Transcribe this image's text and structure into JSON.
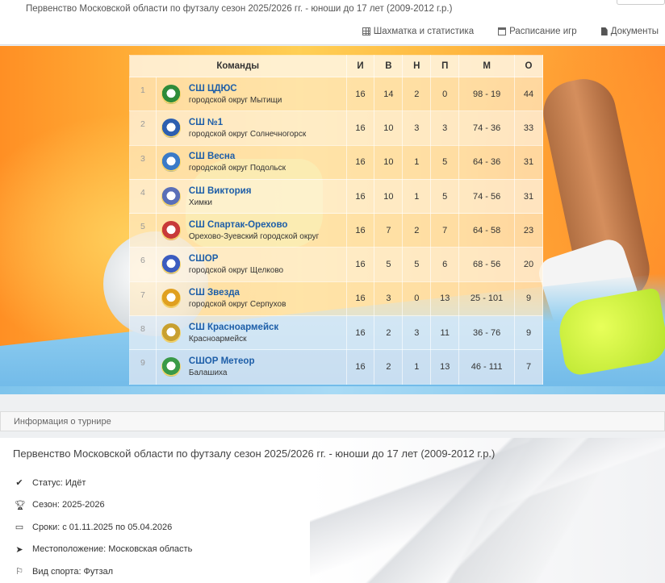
{
  "header": {
    "title": "Первенство Московской области по футзалу сезон 2025/2026 гг. - юноши до 17 лет (2009-2012 г.р.)",
    "nav": [
      {
        "label": "Шахматка и статистика",
        "icon": "grid-icon"
      },
      {
        "label": "Расписание игр",
        "icon": "calendar-icon"
      },
      {
        "label": "Документы",
        "icon": "document-icon"
      }
    ]
  },
  "standings": {
    "headers": {
      "team": "Команды",
      "games": "И",
      "wins": "В",
      "draws": "Н",
      "losses": "П",
      "goals": "М",
      "points": "О"
    },
    "rows": [
      {
        "pos": "1",
        "name": "СШ ЦДЮС",
        "loc": "городской округ Мытищи",
        "games": "16",
        "wins": "14",
        "draws": "2",
        "losses": "0",
        "goals": "98 - 19",
        "points": "44",
        "logo": "#2e8b3a"
      },
      {
        "pos": "2",
        "name": "СШ №1",
        "loc": "городской округ Солнечногорск",
        "games": "16",
        "wins": "10",
        "draws": "3",
        "losses": "3",
        "goals": "74 - 36",
        "points": "33",
        "logo": "#2d5fb0"
      },
      {
        "pos": "3",
        "name": "СШ Весна",
        "loc": "городской округ Подольск",
        "games": "16",
        "wins": "10",
        "draws": "1",
        "losses": "5",
        "goals": "64 - 36",
        "points": "31",
        "logo": "#3a7ac8"
      },
      {
        "pos": "4",
        "name": "СШ Виктория",
        "loc": "Химки",
        "games": "16",
        "wins": "10",
        "draws": "1",
        "losses": "5",
        "goals": "74 - 56",
        "points": "31",
        "logo": "#5a6fb8"
      },
      {
        "pos": "5",
        "name": "СШ Спартак-Орехово",
        "loc": "Орехово-Зуевский городской округ",
        "games": "16",
        "wins": "7",
        "draws": "2",
        "losses": "7",
        "goals": "64 - 58",
        "points": "23",
        "logo": "#c83a3a"
      },
      {
        "pos": "6",
        "name": "СШОР",
        "loc": "городской округ Щелково",
        "games": "16",
        "wins": "5",
        "draws": "5",
        "losses": "6",
        "goals": "68 - 56",
        "points": "20",
        "logo": "#3b5cc0"
      },
      {
        "pos": "7",
        "name": "СШ Звезда",
        "loc": "городской округ Серпухов",
        "games": "16",
        "wins": "3",
        "draws": "0",
        "losses": "13",
        "goals": "25 - 101",
        "points": "9",
        "logo": "#e0a020"
      },
      {
        "pos": "8",
        "name": "СШ Красноармейск",
        "loc": "Красноармейск",
        "games": "16",
        "wins": "2",
        "draws": "3",
        "losses": "11",
        "goals": "36 - 76",
        "points": "9",
        "logo": "#c8a030"
      },
      {
        "pos": "9",
        "name": "СШОР Метеор",
        "loc": "Балашиха",
        "games": "16",
        "wins": "2",
        "draws": "1",
        "losses": "13",
        "goals": "46 - 111",
        "points": "7",
        "logo": "#3a9a48"
      }
    ]
  },
  "info": {
    "section_label": "Информация о турнире",
    "title": "Первенство Московской области по футзалу сезон 2025/2026 гг. - юноши до 17 лет (2009-2012 г.р.)",
    "items": [
      {
        "icon": "check-icon",
        "text": "Статус: Идёт"
      },
      {
        "icon": "trophy-icon",
        "text": "Сезон: 2025-2026"
      },
      {
        "icon": "calendar-icon",
        "text": "Сроки: с 01.11.2025 по 05.04.2026"
      },
      {
        "icon": "location-arrow-icon",
        "text": "Местоположение: Московская область"
      },
      {
        "icon": "flag-icon",
        "text": "Вид спорта: Футзал"
      }
    ]
  }
}
